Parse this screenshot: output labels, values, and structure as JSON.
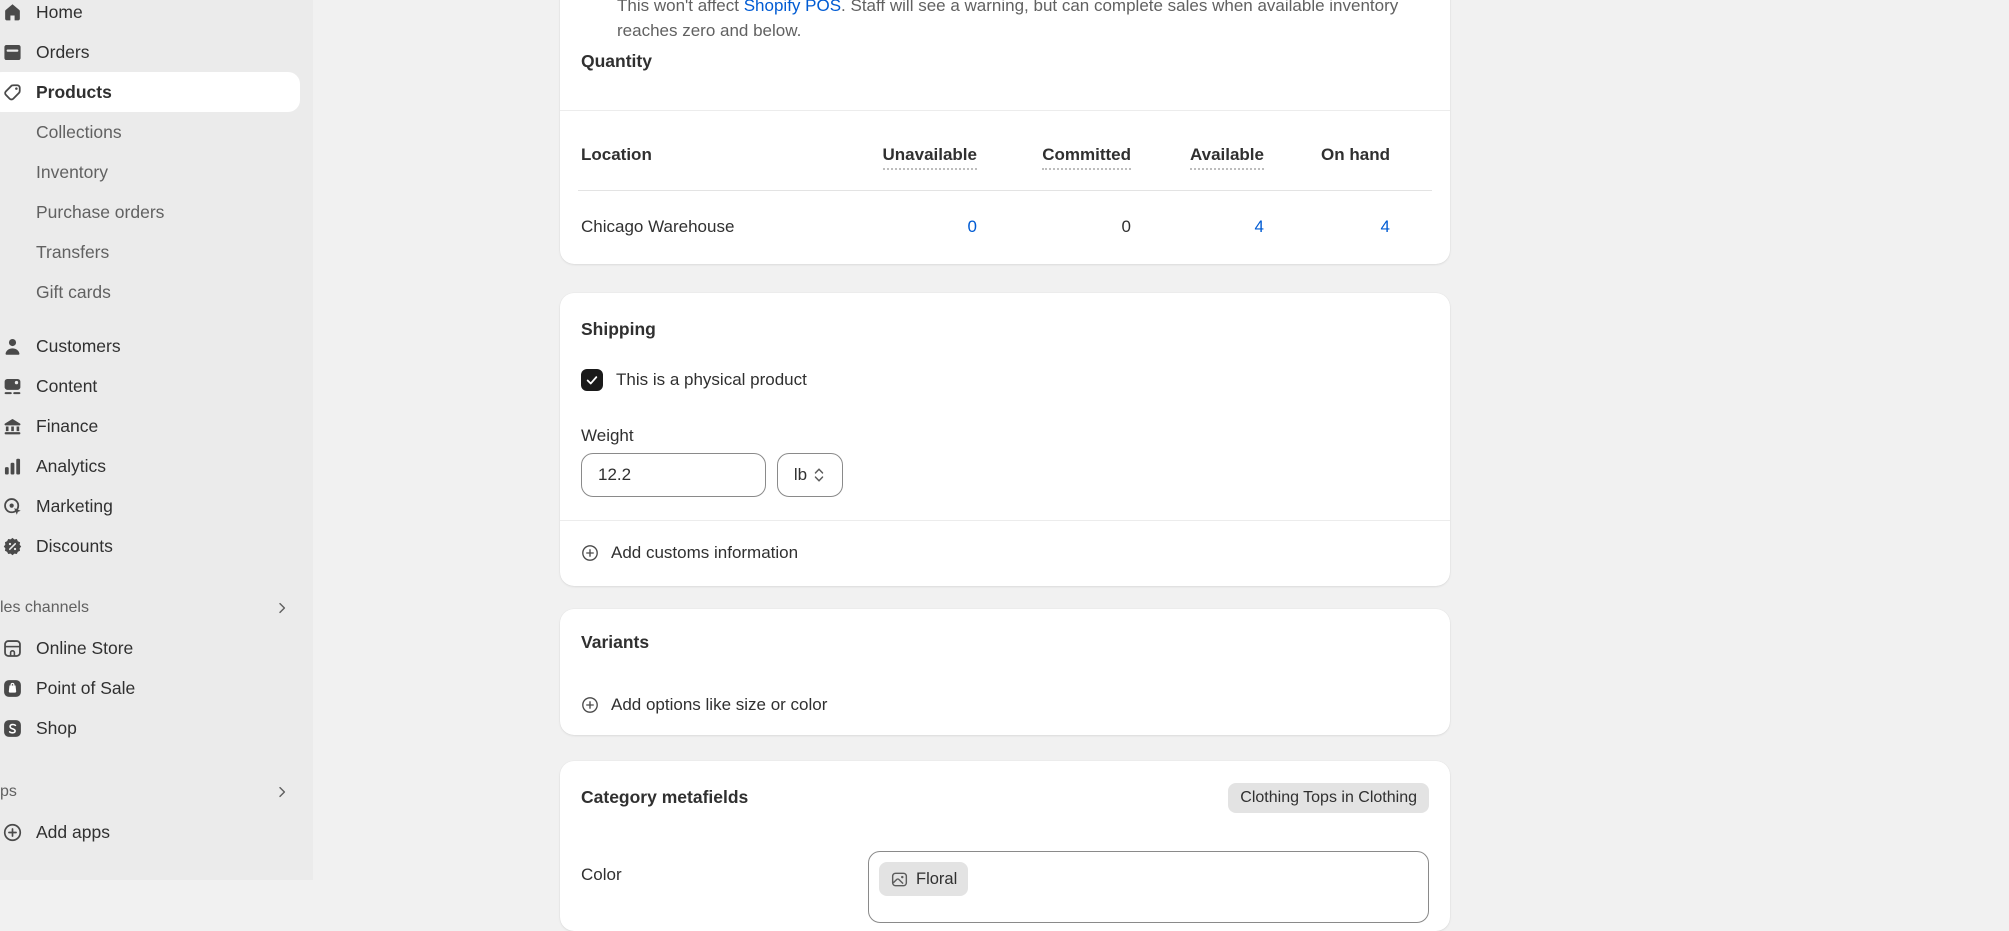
{
  "colors": {
    "app_bg": "#f1f1f1",
    "sidebar_bg": "#ebebeb",
    "card_bg": "#ffffff",
    "text": "#303030",
    "text_secondary": "#616161",
    "link_blue": "#005bd3",
    "checkbox_bg": "#1a1a1a",
    "badge_bg": "#e3e3e3",
    "input_border": "#8a8a8a"
  },
  "sidebar": {
    "items": [
      {
        "label": "Home",
        "icon": "home-icon"
      },
      {
        "label": "Orders",
        "icon": "orders-icon"
      },
      {
        "label": "Products",
        "icon": "products-tag-icon",
        "selected": true
      },
      {
        "label": "Collections"
      },
      {
        "label": "Inventory"
      },
      {
        "label": "Purchase orders"
      },
      {
        "label": "Transfers"
      },
      {
        "label": "Gift cards"
      },
      {
        "label": "Customers",
        "icon": "customers-icon"
      },
      {
        "label": "Content",
        "icon": "content-icon"
      },
      {
        "label": "Finance",
        "icon": "finance-icon"
      },
      {
        "label": "Analytics",
        "icon": "analytics-icon"
      },
      {
        "label": "Marketing",
        "icon": "marketing-icon"
      },
      {
        "label": "Discounts",
        "icon": "discounts-icon"
      },
      {
        "label": "Online Store",
        "icon": "online-store-icon"
      },
      {
        "label": "Point of Sale",
        "icon": "point-of-sale-icon"
      },
      {
        "label": "Shop",
        "icon": "shop-icon"
      },
      {
        "label": "Add apps",
        "icon": "add-apps-icon"
      }
    ],
    "section_headers": [
      {
        "label": "les channels",
        "icon": "chevron-right-icon"
      },
      {
        "label": "ps",
        "icon": "chevron-right-icon"
      }
    ]
  },
  "inventory_card": {
    "description_part1": "This won't affect ",
    "description_link": "Shopify POS",
    "description_part2": ". Staff will see a warning, but can complete sales when available inventory reaches zero and below.",
    "quantity_label": "Quantity",
    "table": {
      "columns": [
        "Location",
        "Unavailable",
        "Committed",
        "Available",
        "On hand"
      ],
      "rows": [
        {
          "location": "Chicago Warehouse",
          "unavailable": "0",
          "committed": "0",
          "available": "4",
          "on_hand": "4"
        }
      ]
    }
  },
  "shipping_card": {
    "title": "Shipping",
    "physical_product_label": "This is a physical product",
    "physical_product_checked": true,
    "weight_label": "Weight",
    "weight_value": "12.2",
    "weight_unit": "lb",
    "add_customs_label": "Add customs information"
  },
  "variants_card": {
    "title": "Variants",
    "add_options_label": "Add options like size or color"
  },
  "category_metafields_card": {
    "title": "Category metafields",
    "category_badge": "Clothing Tops in Clothing",
    "fields": [
      {
        "label": "Color",
        "value_tag": "Floral"
      }
    ]
  }
}
